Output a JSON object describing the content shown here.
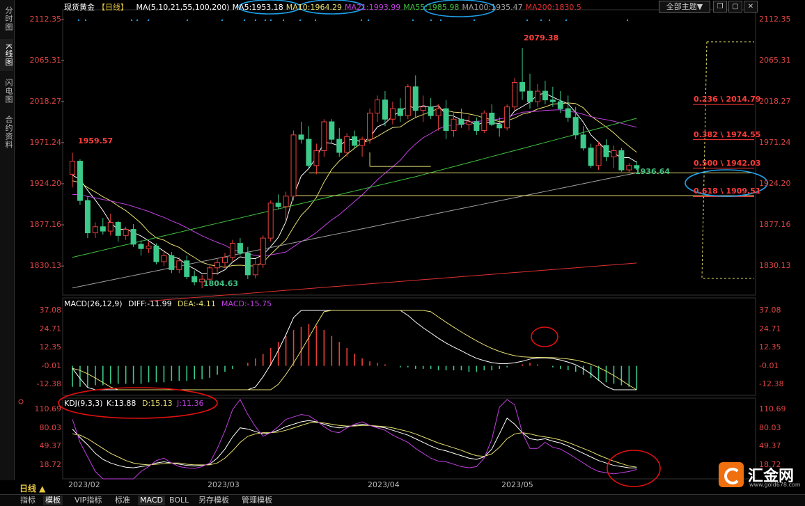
{
  "sidebar": {
    "tabs": [
      {
        "label": "分时图",
        "active": false
      },
      {
        "label": "K线图",
        "active": true
      },
      {
        "label": "闪电图",
        "active": false
      },
      {
        "label": "合约资料",
        "active": false
      }
    ]
  },
  "header": {
    "instrument": "现货黄金",
    "period_tag": "【日线】",
    "ma_params": "MA(5,10,21,55,100,200)",
    "ma5": "MA5:1953.18",
    "ma10": "MA10:1964.29",
    "ma21": "MA21:1993.99",
    "ma55": "MA55:1985.98",
    "ma100": "MA100:1935.47",
    "ma200": "MA200:1830.5",
    "theme_button": "全部主题▼"
  },
  "price_axis": [
    "2112.35",
    "2065.31",
    "2018.27",
    "1971.24",
    "1924.20",
    "1877.16",
    "1830.13"
  ],
  "annotations": {
    "high": "2079.38",
    "left_high": "1959.57",
    "low": "1804.63",
    "last_low": "1936.64"
  },
  "fibonacci": [
    {
      "label": "0.236 \\ 2014.79",
      "price": 2014.79
    },
    {
      "label": "0.382 \\ 1974.55",
      "price": 1974.55
    },
    {
      "label": "0.500 \\ 1942.03",
      "price": 1942.03
    },
    {
      "label": "0.618 \\ 1909.51",
      "price": 1909.51
    }
  ],
  "macd": {
    "title": "MACD(26,12,9)",
    "diff": "DIFF:-11.99",
    "dea": "DEA:-4.11",
    "macd": "MACD:-15.75",
    "axis": [
      "37.08",
      "24.71",
      "12.35",
      "-0.01",
      "-12.38"
    ]
  },
  "kdj": {
    "title": "KDJ(9,3,3)",
    "k": "K:13.88",
    "d": "D:15.13",
    "j": "J:11.36",
    "axis": [
      "110.69",
      "80.03",
      "49.37",
      "18.72"
    ]
  },
  "dates": [
    "2023/02",
    "2023/03",
    "2023/04",
    "2023/05"
  ],
  "period_selector": "日线 ▲",
  "bottom_tabs": [
    {
      "label": "指标",
      "active": false
    },
    {
      "label": "模板",
      "active": true
    },
    {
      "label": "VIP指标",
      "active": false
    },
    {
      "label": "标准",
      "active": false
    },
    {
      "label": "MACD",
      "active": true
    },
    {
      "label": "BOLL",
      "active": false
    },
    {
      "label": "另存模板",
      "active": false
    },
    {
      "label": "管理模板",
      "active": false
    }
  ],
  "logo": {
    "text": "汇金网",
    "sub": "www.gold678.com"
  },
  "colors": {
    "up": "#e8413a",
    "down": "#3cc98a",
    "ma5": "#ffffff",
    "ma10": "#e8e070",
    "ma21": "#c040e0",
    "ma55": "#40c040",
    "ma100": "#a0a0a0",
    "ma200": "#e03030",
    "fib": "#ff3b3b",
    "annot_circle": "#1fa0e8",
    "kdj_circle": "#e01010"
  },
  "chart_data": {
    "type": "candlestick",
    "ohlc": [
      [
        1935,
        1959.57,
        1920,
        1950
      ],
      [
        1950,
        1952,
        1900,
        1905
      ],
      [
        1905,
        1910,
        1862,
        1868
      ],
      [
        1868,
        1880,
        1862,
        1875
      ],
      [
        1875,
        1885,
        1866,
        1870
      ],
      [
        1870,
        1890,
        1865,
        1880
      ],
      [
        1880,
        1882,
        1858,
        1865
      ],
      [
        1865,
        1875,
        1860,
        1872
      ],
      [
        1872,
        1878,
        1852,
        1855
      ],
      [
        1855,
        1860,
        1842,
        1850
      ],
      [
        1850,
        1858,
        1845,
        1853
      ],
      [
        1853,
        1856,
        1832,
        1835
      ],
      [
        1835,
        1848,
        1830,
        1842
      ],
      [
        1842,
        1846,
        1822,
        1826
      ],
      [
        1826,
        1840,
        1822,
        1836
      ],
      [
        1836,
        1842,
        1815,
        1818
      ],
      [
        1818,
        1825,
        1808,
        1812
      ],
      [
        1812,
        1820,
        1804.63,
        1815
      ],
      [
        1815,
        1832,
        1810,
        1828
      ],
      [
        1828,
        1838,
        1820,
        1834
      ],
      [
        1834,
        1845,
        1828,
        1840
      ],
      [
        1840,
        1860,
        1836,
        1856
      ],
      [
        1856,
        1862,
        1842,
        1845
      ],
      [
        1845,
        1852,
        1815,
        1820
      ],
      [
        1820,
        1838,
        1816,
        1832
      ],
      [
        1832,
        1865,
        1828,
        1862
      ],
      [
        1862,
        1905,
        1858,
        1902
      ],
      [
        1902,
        1912,
        1895,
        1898
      ],
      [
        1898,
        1915,
        1882,
        1910
      ],
      [
        1910,
        1985,
        1905,
        1980
      ],
      [
        1980,
        1995,
        1970,
        1975
      ],
      [
        1975,
        1990,
        1942,
        1945
      ],
      [
        1945,
        1970,
        1935,
        1962
      ],
      [
        1962,
        1998,
        1955,
        1995
      ],
      [
        1995,
        1998,
        1970,
        1975
      ],
      [
        1975,
        1988,
        1955,
        1960
      ],
      [
        1960,
        1982,
        1955,
        1978
      ],
      [
        1978,
        1985,
        1965,
        1968
      ],
      [
        1968,
        1978,
        1955,
        1975
      ],
      [
        1975,
        2010,
        1970,
        2005
      ],
      [
        2005,
        2025,
        1995,
        2020
      ],
      [
        2020,
        2030,
        1990,
        1998
      ],
      [
        1998,
        2018,
        1992,
        2010
      ],
      [
        2010,
        2022,
        1995,
        2002
      ],
      [
        2002,
        2038,
        1998,
        2035
      ],
      [
        2035,
        2048,
        2000,
        2008
      ],
      [
        2008,
        2025,
        1995,
        2012
      ],
      [
        2012,
        2022,
        1998,
        2002
      ],
      [
        2002,
        2015,
        1985,
        2010
      ],
      [
        2010,
        2020,
        1975,
        1985
      ],
      [
        1985,
        2005,
        1978,
        1998
      ],
      [
        1998,
        2010,
        1988,
        1992
      ],
      [
        1992,
        2002,
        1985,
        1995
      ],
      [
        1995,
        2000,
        1980,
        1985
      ],
      [
        1985,
        2008,
        1982,
        2005
      ],
      [
        2005,
        2015,
        1990,
        1992
      ],
      [
        1992,
        2000,
        1978,
        1988
      ],
      [
        1988,
        2015,
        1985,
        2012
      ],
      [
        2012,
        2045,
        2008,
        2040
      ],
      [
        2040,
        2079.38,
        2020,
        2030
      ],
      [
        2030,
        2050,
        2010,
        2018
      ],
      [
        2018,
        2038,
        2012,
        2030
      ],
      [
        2030,
        2042,
        2015,
        2020
      ],
      [
        2020,
        2035,
        2012,
        2018
      ],
      [
        2018,
        2030,
        2005,
        2010
      ],
      [
        2010,
        2025,
        1995,
        2000
      ],
      [
        2000,
        2012,
        1975,
        1980
      ],
      [
        1980,
        1990,
        1962,
        1965
      ],
      [
        1965,
        1970,
        1942,
        1945
      ],
      [
        1945,
        1972,
        1940,
        1968
      ],
      [
        1968,
        1975,
        1950,
        1955
      ],
      [
        1955,
        1968,
        1942,
        1962
      ],
      [
        1962,
        1965,
        1938,
        1940
      ],
      [
        1940,
        1948,
        1936.64,
        1945
      ],
      [
        1945,
        1950,
        1940,
        1942
      ]
    ],
    "macd_hist": [
      -14,
      -14,
      -14,
      -13,
      -13,
      -12,
      -12,
      -12,
      -12,
      -12,
      -11,
      -11,
      -11,
      -10,
      -10,
      -10,
      -9,
      -9,
      -8,
      -6,
      -4,
      -2,
      0,
      2,
      5,
      8,
      12,
      16,
      20,
      24,
      26,
      28,
      27,
      24,
      20,
      16,
      12,
      8,
      5,
      3,
      2,
      1,
      0,
      -1,
      -1,
      -2,
      -2,
      -2,
      -3,
      -3,
      -3,
      -3,
      -4,
      -4,
      -3,
      -3,
      -2,
      -1,
      0,
      1,
      2,
      1,
      0,
      -1,
      -2,
      -3,
      -4,
      -6,
      -8,
      -10,
      -11,
      -12,
      -13,
      -14,
      -15.75
    ],
    "kdj_k": [
      78,
      64,
      52,
      38,
      28,
      22,
      18,
      15,
      14,
      16,
      18,
      22,
      24,
      22,
      20,
      18,
      17,
      18,
      20,
      30,
      45,
      65,
      80,
      78,
      74,
      70,
      72,
      76,
      82,
      86,
      90,
      92,
      90,
      86,
      82,
      80,
      82,
      84,
      86,
      84,
      82,
      80,
      76,
      72,
      68,
      62,
      56,
      50,
      45,
      42,
      38,
      34,
      30,
      28,
      32,
      45,
      70,
      96,
      86,
      72,
      62,
      60,
      62,
      58,
      55,
      50,
      44,
      38,
      32,
      26,
      22,
      18,
      16,
      14,
      13.88
    ],
    "kdj_d": [
      70,
      68,
      62,
      54,
      46,
      38,
      32,
      26,
      22,
      20,
      19,
      20,
      21,
      22,
      22,
      20,
      19,
      19,
      19,
      22,
      30,
      42,
      56,
      66,
      70,
      72,
      72,
      73,
      76,
      80,
      84,
      88,
      89,
      88,
      86,
      84,
      83,
      83,
      84,
      84,
      83,
      82,
      80,
      77,
      74,
      70,
      65,
      60,
      55,
      51,
      47,
      43,
      38,
      34,
      33,
      37,
      48,
      62,
      70,
      72,
      70,
      67,
      65,
      63,
      60,
      56,
      51,
      46,
      41,
      35,
      30,
      25,
      21,
      17,
      15.13
    ],
    "kdj_j": [
      94,
      56,
      32,
      8,
      -8,
      -10,
      -10,
      -8,
      -6,
      8,
      16,
      26,
      30,
      22,
      16,
      14,
      13,
      16,
      22,
      46,
      75,
      110,
      128,
      102,
      82,
      66,
      72,
      82,
      94,
      98,
      102,
      100,
      92,
      82,
      74,
      72,
      80,
      86,
      90,
      84,
      80,
      76,
      68,
      62,
      56,
      46,
      38,
      30,
      25,
      24,
      20,
      16,
      14,
      16,
      30,
      61,
      114,
      164,
      118,
      72,
      46,
      46,
      56,
      48,
      45,
      38,
      30,
      22,
      14,
      8,
      6,
      4,
      6,
      8,
      11.36
    ]
  }
}
